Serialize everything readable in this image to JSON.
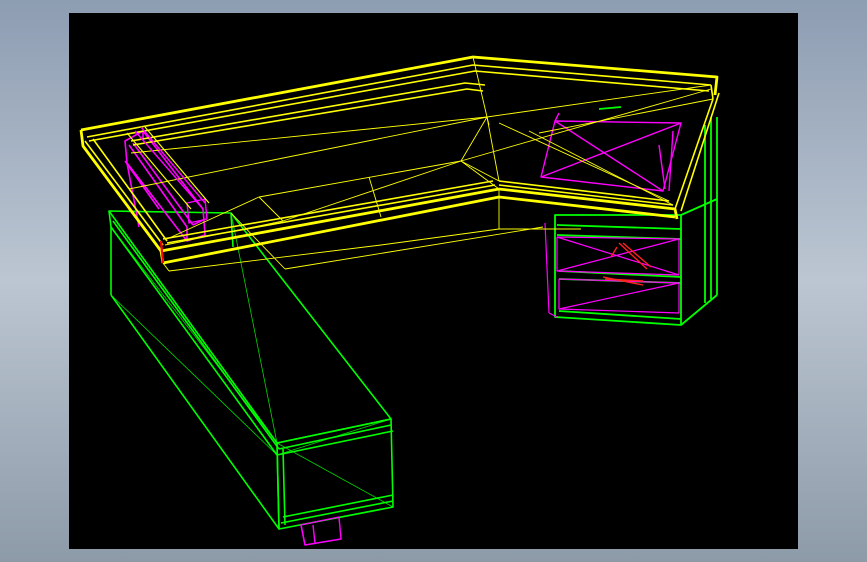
{
  "app": {
    "window_title": ""
  },
  "viewport": {
    "background": "#000000",
    "render_mode": "wireframe",
    "model": "L-shaped desk",
    "parts": [
      {
        "name": "tabletop",
        "color": "#ffff00"
      },
      {
        "name": "left-pedestal",
        "color": "#00ff00"
      },
      {
        "name": "right-drawer-cabinet",
        "color": "#00ff00"
      },
      {
        "name": "support-brackets",
        "color": "#ff00ff"
      },
      {
        "name": "edge-highlight",
        "color": "#ff0000"
      }
    ]
  },
  "colors": {
    "frame_background": "#a6b3c4",
    "yellow": "#ffff00",
    "green": "#00ff00",
    "magenta": "#ff00ff",
    "red": "#ff0000"
  }
}
